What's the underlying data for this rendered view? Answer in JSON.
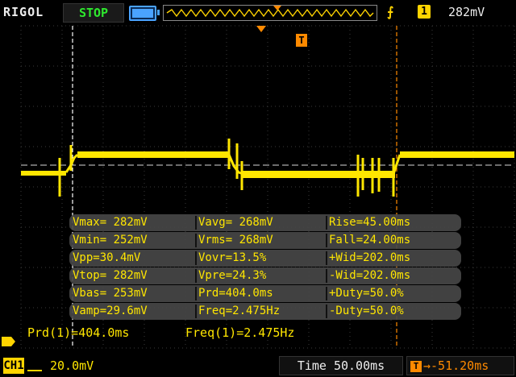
{
  "brand": "RIGOL",
  "run_state": "STOP",
  "trigger": {
    "channel": "1",
    "level": "282mV",
    "marker_label": "T"
  },
  "channel": {
    "label": "CH1",
    "scale": "20.0mV"
  },
  "timebase": {
    "label": "Time",
    "value": "50.00ms"
  },
  "trigger_offset": {
    "icon": "T",
    "value": "-51.20ms"
  },
  "measurements": [
    [
      "Vmax= 282mV",
      "Vavg= 268mV",
      "Rise=45.00ms"
    ],
    [
      "Vmin= 252mV",
      "Vrms= 268mV",
      "Fall=24.00ms"
    ],
    [
      "Vpp=30.4mV",
      "Vovr=13.5%",
      "+Wid=202.0ms"
    ],
    [
      "Vtop= 282mV",
      "Vpre=24.3%",
      "-Wid=202.0ms"
    ],
    [
      "Vbas= 253mV",
      "Prd=404.0ms",
      "+Duty=50.0%"
    ],
    [
      "Vamp=29.6mV",
      "Freq=2.475Hz",
      "-Duty=50.0%"
    ]
  ],
  "cursor_readouts": {
    "period": "Prd(1)=404.0ms",
    "frequency": "Freq(1)=2.475Hz"
  },
  "colors": {
    "trace": "#ffe600",
    "grid": "#3a3a3a",
    "run_state": "#2ee82e",
    "trigger_offset": "#ff8a00"
  }
}
